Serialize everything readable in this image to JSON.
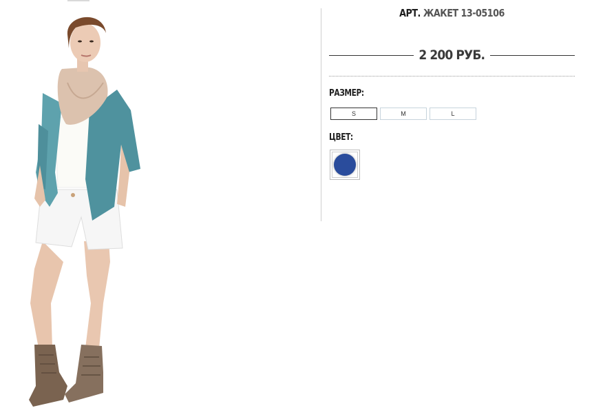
{
  "product": {
    "title_prefix": "АРТ.",
    "title_article": "ЖАКЕТ 13-05106",
    "price": "2 200 РУБ."
  },
  "size": {
    "label": "РАЗМЕР:",
    "options": [
      "S",
      "M",
      "L"
    ],
    "selected": "S"
  },
  "color": {
    "label": "ЦВЕТ:",
    "swatches": [
      {
        "value": "#2a4c9c",
        "selected": true
      }
    ]
  },
  "photo": {
    "icon": "model-photo"
  },
  "colors": {
    "text": "#333333",
    "border": "#c6d3dc",
    "divider": "#cfcfcf"
  }
}
